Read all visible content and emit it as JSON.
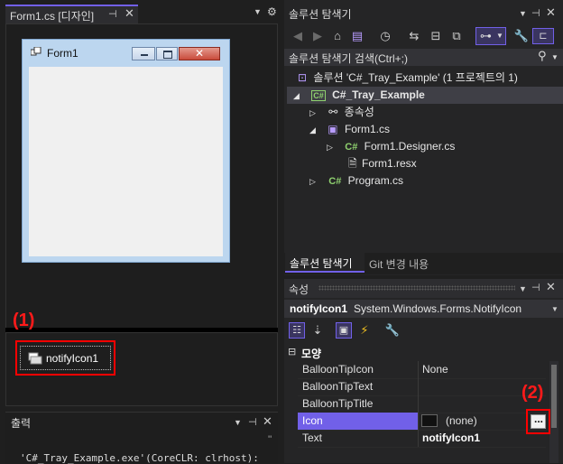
{
  "designer": {
    "tab_title": "Form1.cs [디자인]",
    "form_title": "Form1",
    "component": "notifyIcon1"
  },
  "callouts": {
    "one": "(1)",
    "two": "(2)"
  },
  "output": {
    "title": "출력",
    "text": "'C#_Tray_Example.exe'(CoreCLR: clrhost): 'C:\\",
    "quote_glyph": "''"
  },
  "solution_explorer": {
    "title": "솔루션 탐색기",
    "search_placeholder": "솔루션 탐색기 검색(Ctrl+;)",
    "tree": [
      {
        "label": "솔루션 'C#_Tray_Example' (1 프로젝트의 1)"
      },
      {
        "label": "C#_Tray_Example"
      },
      {
        "label": "종속성"
      },
      {
        "label": "Form1.cs"
      },
      {
        "label": "Form1.Designer.cs"
      },
      {
        "label": "Form1.resx"
      },
      {
        "label": "Program.cs"
      }
    ],
    "cs_badge": "C#",
    "tabs": [
      "솔루션 탐색기",
      "Git 변경 내용"
    ]
  },
  "properties": {
    "title": "속성",
    "object_name": "notifyIcon1",
    "object_type": "System.Windows.Forms.NotifyIcon",
    "category": "모양",
    "rows": [
      {
        "name": "BalloonTipIcon",
        "value": "None"
      },
      {
        "name": "BalloonTipText",
        "value": ""
      },
      {
        "name": "BalloonTipTitle",
        "value": ""
      },
      {
        "name": "Icon",
        "value": "(none)"
      },
      {
        "name": "Text",
        "value": "notifyIcon1"
      }
    ],
    "ellipsis": "..."
  },
  "colors": {
    "accent": "#7160e8",
    "callout": "#ff0000",
    "close": "#c94a3b"
  }
}
